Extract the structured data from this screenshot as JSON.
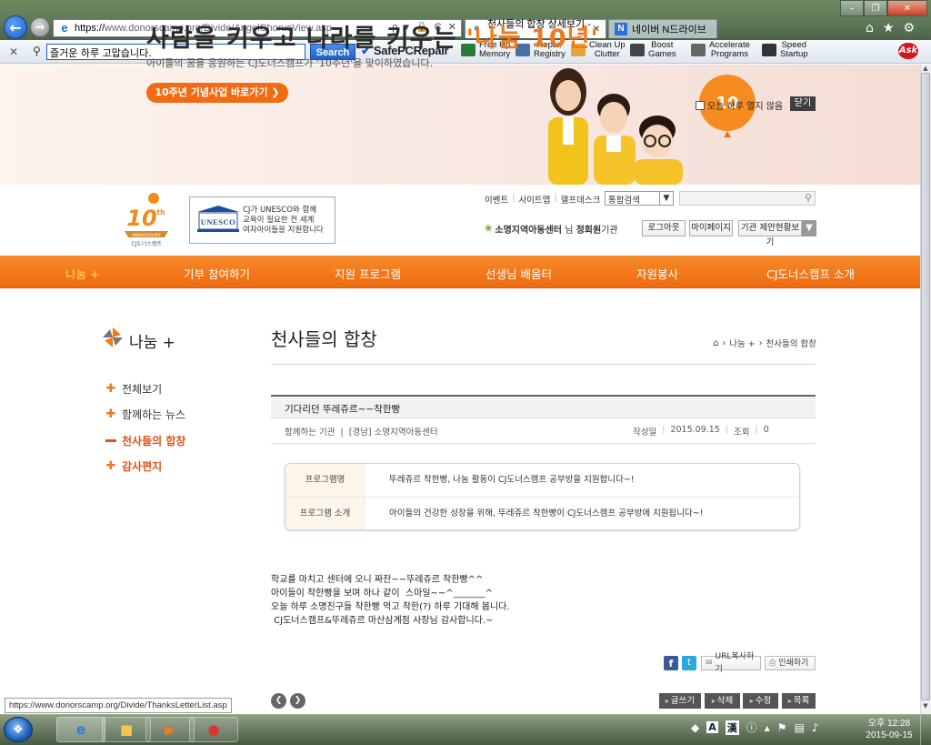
{
  "browser": {
    "address_proto": "https://",
    "address_rest": "www.donorscamp.org/Divide/AngelChorusView.asp",
    "address_tools": "ρ ▾ 🔒 C ✕",
    "tab_active_title": "천사들의 합창 상세보기 - ...",
    "tab_active_close": "✕",
    "tab_naver_title": "네이버 N드라이브",
    "tab_naver_icon": "N",
    "status_url": "https://www.donorscamp.org/Divide/ThanksLetterList.asp"
  },
  "toolbar": {
    "search_value": "즐거운 하루 고맙습니다.",
    "search_button": "Search",
    "safepc": "SafePCRepair",
    "items": [
      {
        "label1": "Free Up",
        "label2": "Memory",
        "color": "#2b7a3a"
      },
      {
        "label1": "Repair",
        "label2": "Registry",
        "color": "#4a6fa5"
      },
      {
        "label1": "Clean Up",
        "label2": "Clutter",
        "color": "#e8a23a"
      },
      {
        "label1": "Boost",
        "label2": "Games",
        "color": "#444444"
      },
      {
        "label1": "Accelerate",
        "label2": "Programs",
        "color": "#666666"
      },
      {
        "label1": "Speed",
        "label2": "Startup",
        "color": "#333333"
      }
    ],
    "ask": "Ask"
  },
  "banner": {
    "headline_a": "사람을 키우고 나라를 키우는 ",
    "headline_b": "'나눔 10년'",
    "sub": "아이들의 꿈을 응원하는 CJ도너스캠프가 '10주년'을 맞이하였습니다.",
    "cta": "10주년 기념사업 바로가기",
    "cta_arrow": "❯",
    "no_show_today": "오늘 하루 열지 않음",
    "close": "닫기",
    "balloon_text": "10"
  },
  "header": {
    "logo_number": "10",
    "logo_sup": "th",
    "logo_anniv": "ANNIVERSARY",
    "logo_brand": "CJ도너스캠프",
    "unesco_word": "UNESCO",
    "unesco_lines": [
      "CJ가 UNESCO와 함께",
      "교육이 필요한 전 세계",
      "여자아이들을 지원합니다"
    ],
    "util_links": [
      "이벤트",
      "사이트맵",
      "헬프데스크"
    ],
    "util_sep": "|",
    "util_select": "통합검색",
    "member_center": "소명지역아동센터",
    "member_suffix": "님",
    "member_name": "정회원",
    "member_type": "기관",
    "btn_logout": "로그아웃",
    "btn_mypage": "마이페이지",
    "btn_status": "기관 제안현황보기"
  },
  "nav": [
    "나눔 +",
    "기부 참여하기",
    "지원 프로그램",
    "선생님 배움터",
    "자원봉사",
    "CJ도너스캠프 소개"
  ],
  "side": {
    "title": "나눔 +",
    "items": [
      "전체보기",
      "함께하는 뉴스",
      "천사들의 합창",
      "감사편지"
    ]
  },
  "content": {
    "page_title": "천사들의 합창",
    "crumb_1": "나눔 +",
    "crumb_2": "천사들의 합창",
    "crumb_arrow": "›",
    "post_title": "기다리던 뚜레쥬르~~착한빵",
    "meta_org_label": "함께하는 기관",
    "meta_org_value": "[경남] 소명지역아동센터",
    "meta_date_label": "작성일",
    "meta_date_value": "2015.09.15",
    "meta_views_label": "조회",
    "meta_views_value": "0",
    "program_name_label": "프로그램명",
    "program_name_value": "뚜레쥬르 착한빵, 나눔 활동이 CJ도너스캠프 공부방을 지원합니다~!",
    "program_desc_label": "프로그램 소개",
    "program_desc_value": "아이들의 건강한 성장을 위해, 뚜레쥬르 착한빵이 CJ도너스캠프 공부방에 지원됩니다~!",
    "body_lines": [
      "학교를 마치고 센터에 오니 짜잔~~뚜레쥬르 착한빵^^",
      "아이들이 착한빵을 보며 하나 같이  스마일~~^_______^",
      "오늘 하루 소명친구들 착한빵 먹고 착한(?) 하루 기대해 봅니다.",
      " CJ도너스캠프&뚜레쥬르 마산삼계점 사장님 감사합니다.~"
    ],
    "share_fb": "f",
    "share_tw": "t",
    "btn_url": "URL복사하기",
    "btn_print": "인쇄하기",
    "btn_write": "글쓰기",
    "btn_delete": "삭제",
    "btn_edit": "수정",
    "btn_list": "목록"
  },
  "taskbar": {
    "ime_a": "A",
    "ime_b": "漢",
    "clock_time": "오후 12:28",
    "clock_date": "2015-09-15"
  },
  "colors": {
    "accent_orange": "#f07a19",
    "nav_orange": "#ee6a0e",
    "active_red": "#e0521a"
  }
}
